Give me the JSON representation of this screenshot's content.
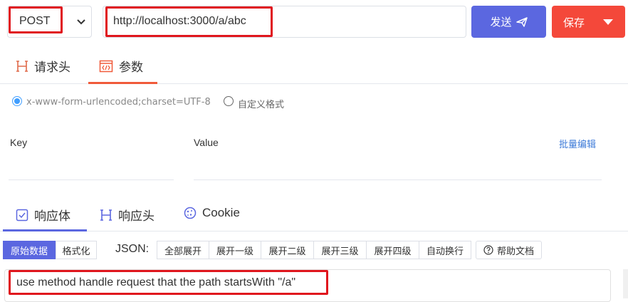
{
  "request": {
    "method": "POST",
    "url": "http://localhost:3000/a/abc",
    "send_label": "发送",
    "save_label": "保存"
  },
  "request_tabs": [
    {
      "label": "请求头",
      "icon": "header-h-icon"
    },
    {
      "label": "参数",
      "icon": "code-icon"
    }
  ],
  "params": {
    "options": [
      {
        "label": "x-www-form-urlencoded;charset=UTF-8",
        "selected": true
      },
      {
        "label": "自定义格式",
        "selected": false
      }
    ],
    "key_header": "Key",
    "value_header": "Value",
    "bulk_edit_label": "批量编辑"
  },
  "response_tabs": [
    {
      "label": "响应体",
      "icon": "checkbox-icon",
      "active": true
    },
    {
      "label": "响应头",
      "icon": "header-h-icon",
      "active": false
    },
    {
      "label": "Cookie",
      "icon": "cookie-icon",
      "active": false
    }
  ],
  "view_modes": [
    "原始数据",
    "格式化"
  ],
  "json_label": "JSON:",
  "json_tools": [
    "全部展开",
    "展开一级",
    "展开二级",
    "展开三级",
    "展开四级",
    "自动换行"
  ],
  "help_label": "帮助文档",
  "response_body": "use method handle request that the path startsWith \"/a\"",
  "colors": {
    "accent": "#5b67e0",
    "danger": "#f4483a",
    "active_tab": "#f05a3a",
    "link": "#3e7bd8",
    "highlight": "#e0161d"
  }
}
